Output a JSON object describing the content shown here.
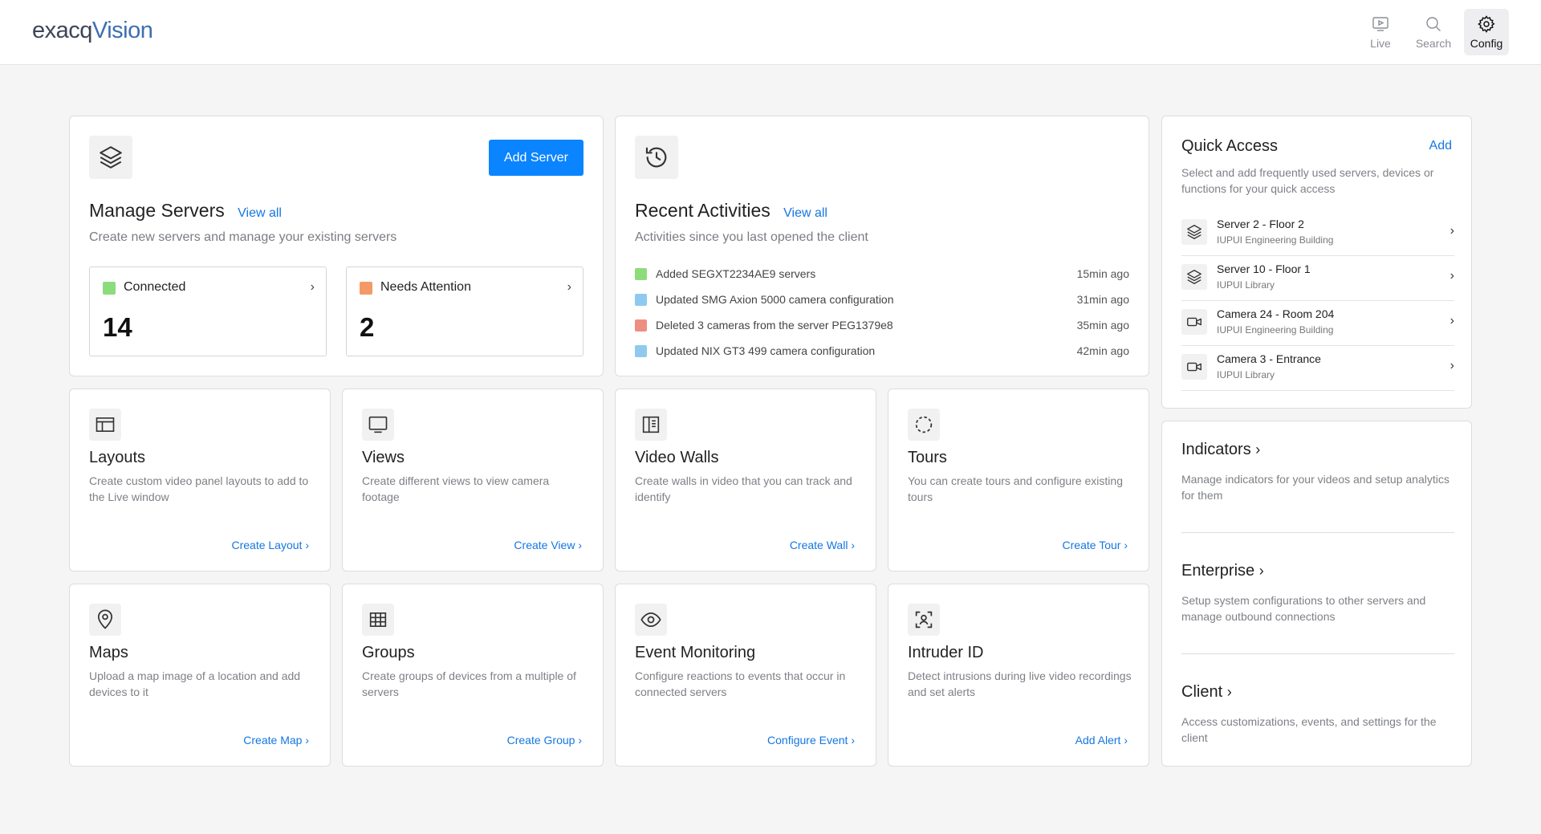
{
  "header": {
    "logo_main": "exacq",
    "logo_accent": "Vision",
    "nav": [
      {
        "label": "Live",
        "icon": "play-monitor-icon"
      },
      {
        "label": "Search",
        "icon": "search-icon"
      },
      {
        "label": "Config",
        "icon": "gear-icon",
        "active": true
      }
    ]
  },
  "servers": {
    "title": "Manage Servers",
    "view_all": "View all",
    "subtitle": "Create new servers and manage your existing servers",
    "add_button": "Add Server",
    "connected": {
      "label": "Connected",
      "count": "14",
      "color": "#8ddc7c"
    },
    "attention": {
      "label": "Needs Attention",
      "count": "2",
      "color": "#f49a66"
    }
  },
  "activities": {
    "title": "Recent Activities",
    "view_all": "View all",
    "subtitle": "Activities since you last opened the client",
    "items": [
      {
        "text": "Added SEGXT2234AE9 servers",
        "time": "15min ago",
        "color": "#8ddc7c"
      },
      {
        "text": "Updated SMG Axion 5000 camera configuration",
        "time": "31min ago",
        "color": "#90c9f0"
      },
      {
        "text": "Deleted 3 cameras from the server PEG1379e8",
        "time": "35min ago",
        "color": "#ee8e83"
      },
      {
        "text": "Updated NIX GT3 499 camera configuration",
        "time": "42min ago",
        "color": "#90c9f0"
      }
    ]
  },
  "quick_access": {
    "title": "Quick Access",
    "add": "Add",
    "desc": "Select and add frequently used servers, devices or functions for your quick access",
    "items": [
      {
        "name": "Server 2 - Floor 2",
        "sub": "IUPUI Engineering Building",
        "icon": "layers-icon"
      },
      {
        "name": "Server 10 - Floor 1",
        "sub": "IUPUI Library",
        "icon": "layers-icon"
      },
      {
        "name": "Camera 24 - Room 204",
        "sub": "IUPUI Engineering Building",
        "icon": "camera-icon"
      },
      {
        "name": "Camera 3 - Entrance",
        "sub": "IUPUI Library",
        "icon": "camera-icon"
      }
    ]
  },
  "features": [
    {
      "title": "Layouts",
      "desc": "Create custom video panel layouts to add to the Live window",
      "action": "Create Layout",
      "icon": "layout-icon"
    },
    {
      "title": "Views",
      "desc": "Create different views to view camera footage",
      "action": "Create View",
      "icon": "monitor-icon"
    },
    {
      "title": "Video Walls",
      "desc": "Create walls in video that you can track and identify",
      "action": "Create Wall",
      "icon": "video-wall-icon"
    },
    {
      "title": "Tours",
      "desc": "You can create tours and configure existing tours",
      "action": "Create Tour",
      "icon": "tour-icon"
    },
    {
      "title": "Maps",
      "desc": "Upload a map image of a location and add  devices to it",
      "action": "Create Map",
      "icon": "map-pin-icon"
    },
    {
      "title": "Groups",
      "desc": "Create groups of devices from a multiple of servers",
      "action": "Create Group",
      "icon": "grid-icon"
    },
    {
      "title": "Event Monitoring",
      "desc": "Configure reactions to events that occur in connected servers",
      "action": "Configure Event",
      "icon": "eye-icon"
    },
    {
      "title": "Intruder ID",
      "desc": "Detect intrusions during live video recordings and set alerts",
      "action": "Add Alert",
      "icon": "face-scan-icon"
    }
  ],
  "side_sections": [
    {
      "title": "Indicators",
      "desc": "Manage indicators for your videos and setup analytics for them"
    },
    {
      "title": "Enterprise",
      "desc": "Setup system configurations to other servers and manage outbound connections"
    },
    {
      "title": "Client",
      "desc": "Access customizations, events, and settings for the client"
    }
  ]
}
